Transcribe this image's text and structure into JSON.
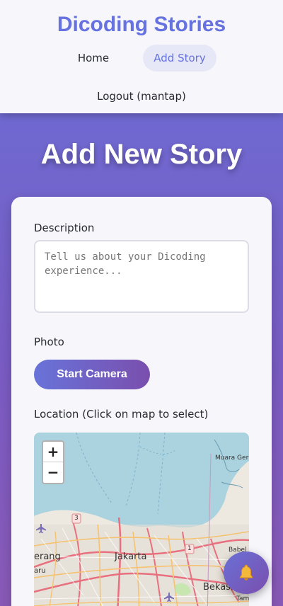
{
  "header": {
    "brand": "Dicoding Stories",
    "nav": {
      "home": "Home",
      "add_story": "Add Story",
      "logout": "Logout (mantap)"
    }
  },
  "page": {
    "title": "Add New Story"
  },
  "form": {
    "description_label": "Description",
    "description_placeholder": "Tell us about your Dicoding experience...",
    "description_value": "",
    "photo_label": "Photo",
    "start_camera_label": "Start Camera",
    "location_label": "Location (Click on map to select)"
  },
  "map": {
    "zoom_in": "+",
    "zoom_out": "−",
    "places": {
      "jakarta": "Jakarta",
      "muara": "Muara Ger",
      "bekasi": "Bekasi",
      "tangerang": "erang",
      "aru": "aru",
      "babel": "Babel",
      "tam": "Tam",
      "route_3": "3",
      "route_1": "1"
    }
  },
  "fab": {
    "icon": "bell-icon"
  },
  "colors": {
    "brand": "#6672df",
    "gradient_start": "#6a6fd6",
    "gradient_end": "#7a4fae"
  }
}
